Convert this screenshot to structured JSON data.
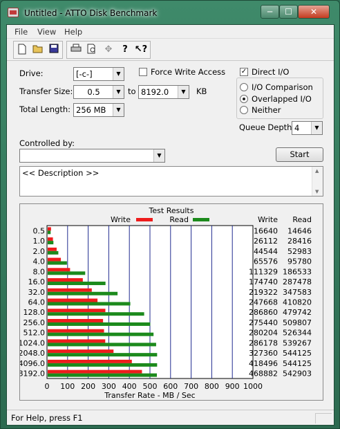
{
  "window": {
    "title": "Untitled - ATTO Disk Benchmark",
    "minimize": "─",
    "maximize": "☐",
    "close": "✕"
  },
  "menu": [
    "File",
    "View",
    "Help"
  ],
  "toolbar_icons": [
    "new-icon",
    "open-icon",
    "save-icon",
    "print-icon",
    "print-preview-icon",
    "move-icon",
    "help-icon",
    "context-help-icon"
  ],
  "form": {
    "drive_label": "Drive:",
    "drive_value": "[-c-]",
    "force_write_label": "Force Write Access",
    "force_write_checked": false,
    "direct_io_label": "Direct I/O",
    "direct_io_checked": true,
    "transfer_size_label": "Transfer Size:",
    "transfer_from": "0.5",
    "to_label": "to",
    "transfer_to": "8192.0",
    "kb_label": "KB",
    "total_length_label": "Total Length:",
    "total_length_value": "256 MB",
    "io_comparison_label": "I/O Comparison",
    "overlapped_io_label": "Overlapped I/O",
    "neither_label": "Neither",
    "selected_io_mode": "Overlapped I/O",
    "queue_depth_label": "Queue Depth:",
    "queue_depth_value": "4",
    "controlled_by_label": "Controlled by:",
    "controlled_by_value": "",
    "start_label": "Start",
    "description_text": "<< Description >>"
  },
  "chart_data": {
    "type": "bar",
    "title": "Test Results",
    "xlabel": "Transfer Rate - MB / Sec",
    "ylabel": "",
    "xlim": [
      0,
      1000
    ],
    "xticks": [
      "0",
      "100",
      "200",
      "300",
      "400",
      "500",
      "600",
      "700",
      "800",
      "900",
      "1000"
    ],
    "categories": [
      "0.5",
      "1.0",
      "2.0",
      "4.0",
      "8.0",
      "16.0",
      "32.0",
      "64.0",
      "128.0",
      "256.0",
      "512.0",
      "1024.0",
      "2048.0",
      "4096.0",
      "8192.0"
    ],
    "series": [
      {
        "name": "Write",
        "color": "#ee1c1c",
        "values": [
          16.3,
          25.5,
          43.5,
          64.0,
          108.7,
          170.6,
          214.2,
          241.9,
          280.1,
          268.9,
          273.6,
          279.5,
          319.7,
          408.7,
          457.9
        ]
      },
      {
        "name": "Read",
        "color": "#1c8a1c",
        "values": [
          14.3,
          27.8,
          51.7,
          93.5,
          182.2,
          280.7,
          339.3,
          401.2,
          468.5,
          497.9,
          514.0,
          526.6,
          531.4,
          531.4,
          530.2
        ]
      }
    ],
    "legend_placement": "top",
    "table": {
      "write_header": "Write",
      "read_header": "Read",
      "write": [
        "16640",
        "26112",
        "44544",
        "65576",
        "111329",
        "174740",
        "219322",
        "247668",
        "286860",
        "275440",
        "280204",
        "286178",
        "327360",
        "418496",
        "468882"
      ],
      "read": [
        "14646",
        "28416",
        "52983",
        "95780",
        "186533",
        "287478",
        "347583",
        "410820",
        "479742",
        "509807",
        "526344",
        "539267",
        "544125",
        "544125",
        "542903"
      ]
    }
  },
  "status": {
    "text": "For Help, press F1"
  }
}
